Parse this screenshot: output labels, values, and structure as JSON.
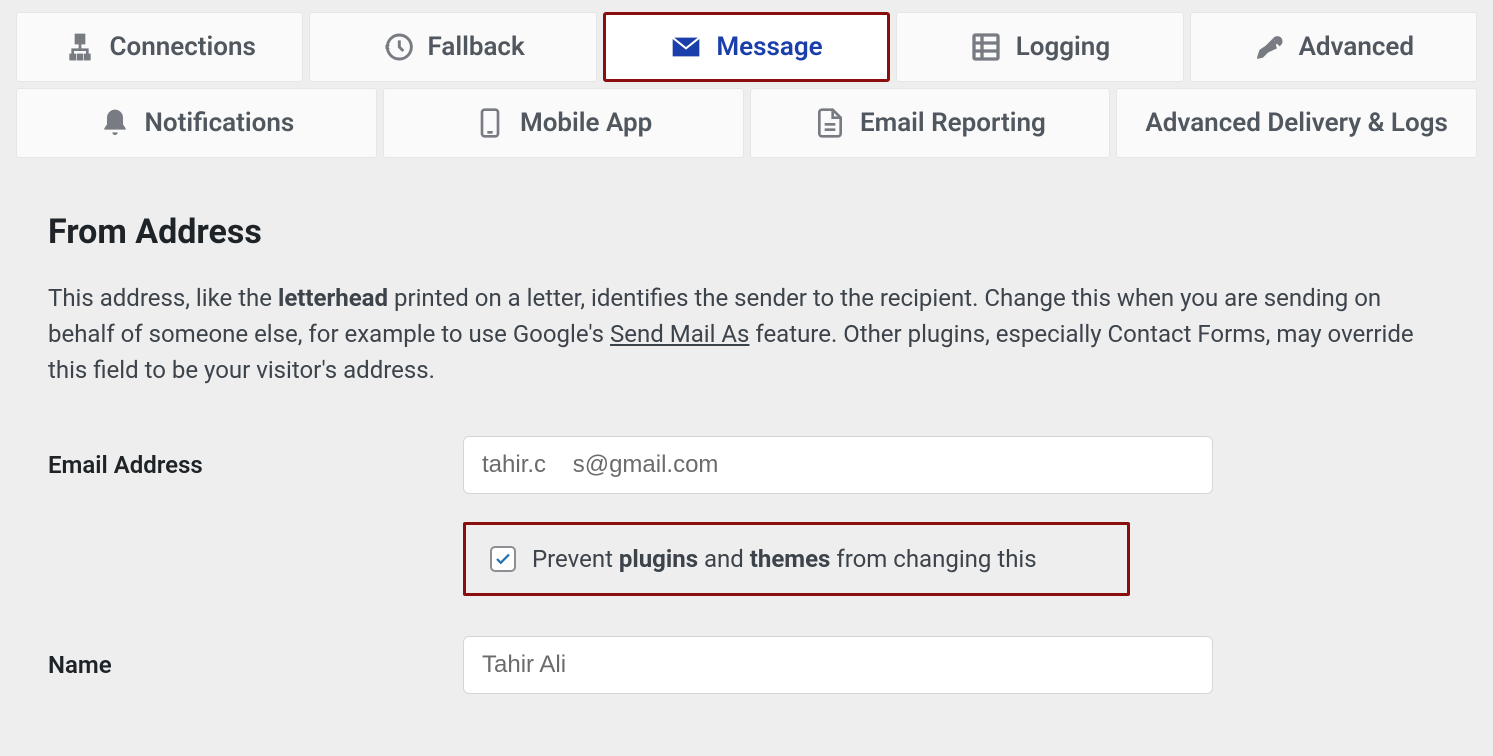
{
  "tabs": {
    "row1": [
      {
        "label": "Connections",
        "icon": "network-icon"
      },
      {
        "label": "Fallback",
        "icon": "history-icon"
      },
      {
        "label": "Message",
        "icon": "envelope-icon",
        "active": true
      },
      {
        "label": "Logging",
        "icon": "list-icon"
      },
      {
        "label": "Advanced",
        "icon": "wrench-icon"
      }
    ],
    "row2": [
      {
        "label": "Notifications",
        "icon": "bell-icon"
      },
      {
        "label": "Mobile App",
        "icon": "phone-icon"
      },
      {
        "label": "Email Reporting",
        "icon": "document-icon"
      },
      {
        "label": "Advanced Delivery & Logs",
        "icon": ""
      }
    ]
  },
  "section": {
    "title": "From Address",
    "desc_pre": "This address, like the ",
    "desc_bold1": "letterhead",
    "desc_mid1": " printed on a letter, identifies the sender to the recipient. Change this when you are sending on behalf of someone else, for example to use Google's ",
    "desc_link": "Send Mail As",
    "desc_post": " feature. Other plugins, especially Contact Forms, may override this field to be your visitor's address."
  },
  "form": {
    "email_label": "Email Address",
    "email_value": "tahir.c    s@gmail.com",
    "name_label": "Name",
    "name_value": "Tahir Ali",
    "checkbox": {
      "pre": "Prevent ",
      "bold1": "plugins",
      "mid": " and ",
      "bold2": "themes",
      "post": " from changing this",
      "checked": true
    }
  }
}
